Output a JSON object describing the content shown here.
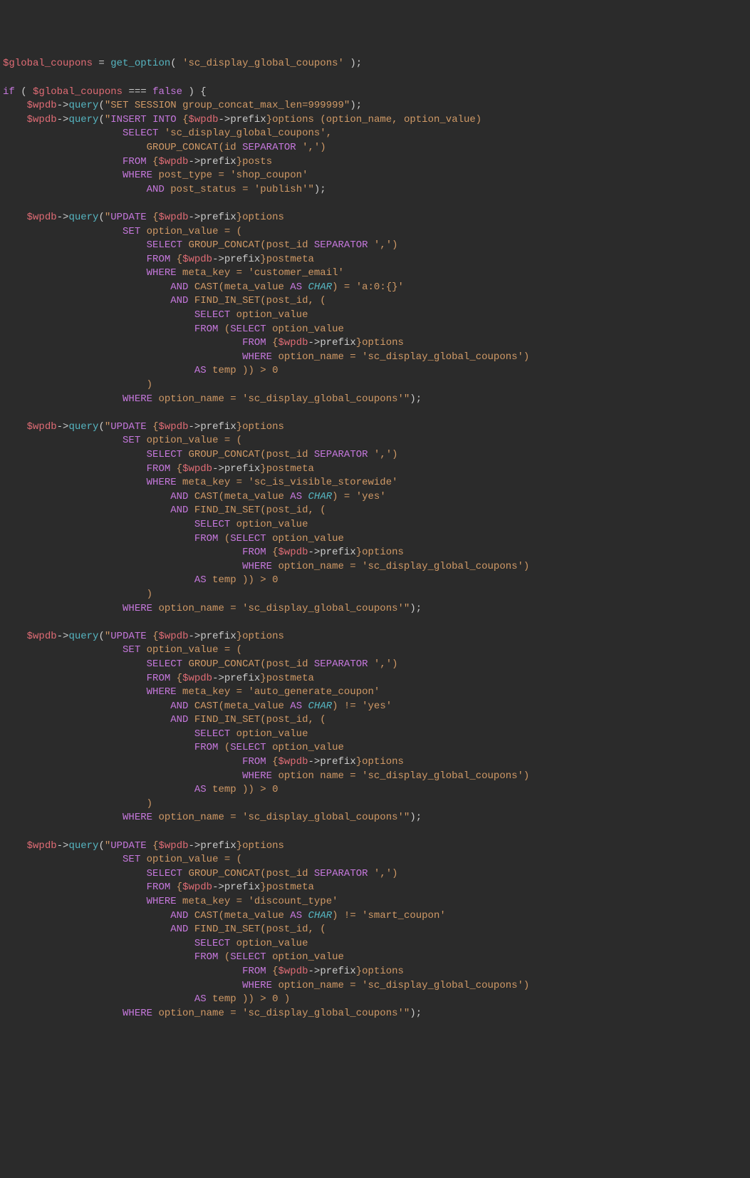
{
  "lines": [
    [
      [
        "var",
        "$global_coupons"
      ],
      [
        "op",
        " = "
      ],
      [
        "func",
        "get_option"
      ],
      [
        "paren",
        "( "
      ],
      [
        "str",
        "'sc_display_global_coupons'"
      ],
      [
        "paren",
        " );"
      ]
    ],
    [
      [
        "plain",
        ""
      ]
    ],
    [
      [
        "kw",
        "if"
      ],
      [
        "paren",
        " ( "
      ],
      [
        "var",
        "$global_coupons"
      ],
      [
        "op",
        " === "
      ],
      [
        "kw",
        "false"
      ],
      [
        "paren",
        " ) {"
      ]
    ],
    [
      [
        "plain",
        "    "
      ],
      [
        "var",
        "$wpdb"
      ],
      [
        "arrow",
        "->"
      ],
      [
        "method",
        "query"
      ],
      [
        "paren",
        "("
      ],
      [
        "str",
        "\"SET SESSION group_concat_max_len=999999\""
      ],
      [
        "paren",
        ");"
      ]
    ],
    [
      [
        "plain",
        "    "
      ],
      [
        "var",
        "$wpdb"
      ],
      [
        "arrow",
        "->"
      ],
      [
        "method",
        "query"
      ],
      [
        "paren",
        "("
      ],
      [
        "q-open",
        "\""
      ],
      [
        "sql-kw",
        "INSERT INTO"
      ],
      [
        "sql-str",
        " {"
      ],
      [
        "var",
        "$wpdb"
      ],
      [
        "arrow",
        "->"
      ],
      [
        "plain",
        "prefix"
      ],
      [
        "sql-str",
        "}options (option_name, option_value)"
      ]
    ],
    [
      [
        "plain",
        "                    "
      ],
      [
        "sql-kw",
        "SELECT"
      ],
      [
        "sql-str",
        " 'sc_display_global_coupons',"
      ]
    ],
    [
      [
        "plain",
        "                        "
      ],
      [
        "sql-str",
        "GROUP_CONCAT(id "
      ],
      [
        "sql-kw",
        "SEPARATOR"
      ],
      [
        "sql-str",
        " ',')"
      ]
    ],
    [
      [
        "plain",
        "                    "
      ],
      [
        "sql-kw",
        "FROM"
      ],
      [
        "sql-str",
        " {"
      ],
      [
        "var",
        "$wpdb"
      ],
      [
        "arrow",
        "->"
      ],
      [
        "plain",
        "prefix"
      ],
      [
        "sql-str",
        "}posts"
      ]
    ],
    [
      [
        "plain",
        "                    "
      ],
      [
        "sql-kw",
        "WHERE"
      ],
      [
        "sql-str",
        " post_type = 'shop_coupon'"
      ]
    ],
    [
      [
        "plain",
        "                        "
      ],
      [
        "sql-kw",
        "AND"
      ],
      [
        "sql-str",
        " post_status = 'publish'\""
      ],
      [
        "paren",
        ");"
      ]
    ],
    [
      [
        "plain",
        ""
      ]
    ],
    [
      [
        "plain",
        "    "
      ],
      [
        "var",
        "$wpdb"
      ],
      [
        "arrow",
        "->"
      ],
      [
        "method",
        "query"
      ],
      [
        "paren",
        "("
      ],
      [
        "q-open",
        "\""
      ],
      [
        "sql-kw",
        "UPDATE"
      ],
      [
        "sql-str",
        " {"
      ],
      [
        "var",
        "$wpdb"
      ],
      [
        "arrow",
        "->"
      ],
      [
        "plain",
        "prefix"
      ],
      [
        "sql-str",
        "}options"
      ]
    ],
    [
      [
        "plain",
        "                    "
      ],
      [
        "sql-kw",
        "SET"
      ],
      [
        "sql-str",
        " option_value = ("
      ]
    ],
    [
      [
        "plain",
        "                        "
      ],
      [
        "sql-kw",
        "SELECT"
      ],
      [
        "sql-str",
        " GROUP_CONCAT(post_id "
      ],
      [
        "sql-kw",
        "SEPARATOR"
      ],
      [
        "sql-str",
        " ',')"
      ]
    ],
    [
      [
        "plain",
        "                        "
      ],
      [
        "sql-kw",
        "FROM"
      ],
      [
        "sql-str",
        " {"
      ],
      [
        "var",
        "$wpdb"
      ],
      [
        "arrow",
        "->"
      ],
      [
        "plain",
        "prefix"
      ],
      [
        "sql-str",
        "}postmeta"
      ]
    ],
    [
      [
        "plain",
        "                        "
      ],
      [
        "sql-kw",
        "WHERE"
      ],
      [
        "sql-str",
        " meta_key = 'customer_email'"
      ]
    ],
    [
      [
        "plain",
        "                            "
      ],
      [
        "sql-kw",
        "AND"
      ],
      [
        "sql-str",
        " CAST(meta_value "
      ],
      [
        "sql-kw",
        "AS"
      ],
      [
        "sql-str",
        " "
      ],
      [
        "sql-type",
        "CHAR"
      ],
      [
        "sql-str",
        ") = 'a:0:{}'"
      ]
    ],
    [
      [
        "plain",
        "                            "
      ],
      [
        "sql-kw",
        "AND"
      ],
      [
        "sql-str",
        " FIND_IN_SET(post_id, ("
      ]
    ],
    [
      [
        "plain",
        "                                "
      ],
      [
        "sql-kw",
        "SELECT"
      ],
      [
        "sql-str",
        " option_value"
      ]
    ],
    [
      [
        "plain",
        "                                "
      ],
      [
        "sql-kw",
        "FROM"
      ],
      [
        "sql-str",
        " ("
      ],
      [
        "sql-kw",
        "SELECT"
      ],
      [
        "sql-str",
        " option_value"
      ]
    ],
    [
      [
        "plain",
        "                                        "
      ],
      [
        "sql-kw",
        "FROM"
      ],
      [
        "sql-str",
        " {"
      ],
      [
        "var",
        "$wpdb"
      ],
      [
        "arrow",
        "->"
      ],
      [
        "plain",
        "prefix"
      ],
      [
        "sql-str",
        "}options"
      ]
    ],
    [
      [
        "plain",
        "                                        "
      ],
      [
        "sql-kw",
        "WHERE"
      ],
      [
        "sql-str",
        " option_name = 'sc_display_global_coupons')"
      ]
    ],
    [
      [
        "plain",
        "                                "
      ],
      [
        "sql-kw",
        "AS"
      ],
      [
        "sql-str",
        " temp )) > "
      ],
      [
        "num",
        "0"
      ]
    ],
    [
      [
        "plain",
        "                        "
      ],
      [
        "sql-str",
        ")"
      ]
    ],
    [
      [
        "plain",
        "                    "
      ],
      [
        "sql-kw",
        "WHERE"
      ],
      [
        "sql-str",
        " option_name = 'sc_display_global_coupons'\""
      ],
      [
        "paren",
        ");"
      ]
    ],
    [
      [
        "plain",
        ""
      ]
    ],
    [
      [
        "plain",
        "    "
      ],
      [
        "var",
        "$wpdb"
      ],
      [
        "arrow",
        "->"
      ],
      [
        "method",
        "query"
      ],
      [
        "paren",
        "("
      ],
      [
        "q-open",
        "\""
      ],
      [
        "sql-kw",
        "UPDATE"
      ],
      [
        "sql-str",
        " {"
      ],
      [
        "var",
        "$wpdb"
      ],
      [
        "arrow",
        "->"
      ],
      [
        "plain",
        "prefix"
      ],
      [
        "sql-str",
        "}options"
      ]
    ],
    [
      [
        "plain",
        "                    "
      ],
      [
        "sql-kw",
        "SET"
      ],
      [
        "sql-str",
        " option_value = ("
      ]
    ],
    [
      [
        "plain",
        "                        "
      ],
      [
        "sql-kw",
        "SELECT"
      ],
      [
        "sql-str",
        " GROUP_CONCAT(post_id "
      ],
      [
        "sql-kw",
        "SEPARATOR"
      ],
      [
        "sql-str",
        " ',')"
      ]
    ],
    [
      [
        "plain",
        "                        "
      ],
      [
        "sql-kw",
        "FROM"
      ],
      [
        "sql-str",
        " {"
      ],
      [
        "var",
        "$wpdb"
      ],
      [
        "arrow",
        "->"
      ],
      [
        "plain",
        "prefix"
      ],
      [
        "sql-str",
        "}postmeta"
      ]
    ],
    [
      [
        "plain",
        "                        "
      ],
      [
        "sql-kw",
        "WHERE"
      ],
      [
        "sql-str",
        " meta_key = 'sc_is_visible_storewide'"
      ]
    ],
    [
      [
        "plain",
        "                            "
      ],
      [
        "sql-kw",
        "AND"
      ],
      [
        "sql-str",
        " CAST(meta_value "
      ],
      [
        "sql-kw",
        "AS"
      ],
      [
        "sql-str",
        " "
      ],
      [
        "sql-type",
        "CHAR"
      ],
      [
        "sql-str",
        ") = 'yes'"
      ]
    ],
    [
      [
        "plain",
        "                            "
      ],
      [
        "sql-kw",
        "AND"
      ],
      [
        "sql-str",
        " FIND_IN_SET(post_id, ("
      ]
    ],
    [
      [
        "plain",
        "                                "
      ],
      [
        "sql-kw",
        "SELECT"
      ],
      [
        "sql-str",
        " option_value"
      ]
    ],
    [
      [
        "plain",
        "                                "
      ],
      [
        "sql-kw",
        "FROM"
      ],
      [
        "sql-str",
        " ("
      ],
      [
        "sql-kw",
        "SELECT"
      ],
      [
        "sql-str",
        " option_value"
      ]
    ],
    [
      [
        "plain",
        "                                        "
      ],
      [
        "sql-kw",
        "FROM"
      ],
      [
        "sql-str",
        " {"
      ],
      [
        "var",
        "$wpdb"
      ],
      [
        "arrow",
        "->"
      ],
      [
        "plain",
        "prefix"
      ],
      [
        "sql-str",
        "}options"
      ]
    ],
    [
      [
        "plain",
        "                                        "
      ],
      [
        "sql-kw",
        "WHERE"
      ],
      [
        "sql-str",
        " option_name = 'sc_display_global_coupons')"
      ]
    ],
    [
      [
        "plain",
        "                                "
      ],
      [
        "sql-kw",
        "AS"
      ],
      [
        "sql-str",
        " temp )) > "
      ],
      [
        "num",
        "0"
      ]
    ],
    [
      [
        "plain",
        "                        "
      ],
      [
        "sql-str",
        ")"
      ]
    ],
    [
      [
        "plain",
        "                    "
      ],
      [
        "sql-kw",
        "WHERE"
      ],
      [
        "sql-str",
        " option_name = 'sc_display_global_coupons'\""
      ],
      [
        "paren",
        ");"
      ]
    ],
    [
      [
        "plain",
        ""
      ]
    ],
    [
      [
        "plain",
        "    "
      ],
      [
        "var",
        "$wpdb"
      ],
      [
        "arrow",
        "->"
      ],
      [
        "method",
        "query"
      ],
      [
        "paren",
        "("
      ],
      [
        "q-open",
        "\""
      ],
      [
        "sql-kw",
        "UPDATE"
      ],
      [
        "sql-str",
        " {"
      ],
      [
        "var",
        "$wpdb"
      ],
      [
        "arrow",
        "->"
      ],
      [
        "plain",
        "prefix"
      ],
      [
        "sql-str",
        "}options"
      ]
    ],
    [
      [
        "plain",
        "                    "
      ],
      [
        "sql-kw",
        "SET"
      ],
      [
        "sql-str",
        " option_value = ("
      ]
    ],
    [
      [
        "plain",
        "                        "
      ],
      [
        "sql-kw",
        "SELECT"
      ],
      [
        "sql-str",
        " GROUP_CONCAT(post_id "
      ],
      [
        "sql-kw",
        "SEPARATOR"
      ],
      [
        "sql-str",
        " ',')"
      ]
    ],
    [
      [
        "plain",
        "                        "
      ],
      [
        "sql-kw",
        "FROM"
      ],
      [
        "sql-str",
        " {"
      ],
      [
        "var",
        "$wpdb"
      ],
      [
        "arrow",
        "->"
      ],
      [
        "plain",
        "prefix"
      ],
      [
        "sql-str",
        "}postmeta"
      ]
    ],
    [
      [
        "plain",
        "                        "
      ],
      [
        "sql-kw",
        "WHERE"
      ],
      [
        "sql-str",
        " meta_key = 'auto_generate_coupon'"
      ]
    ],
    [
      [
        "plain",
        "                            "
      ],
      [
        "sql-kw",
        "AND"
      ],
      [
        "sql-str",
        " CAST(meta_value "
      ],
      [
        "sql-kw",
        "AS"
      ],
      [
        "sql-str",
        " "
      ],
      [
        "sql-type",
        "CHAR"
      ],
      [
        "sql-str",
        ") != 'yes'"
      ]
    ],
    [
      [
        "plain",
        "                            "
      ],
      [
        "sql-kw",
        "AND"
      ],
      [
        "sql-str",
        " FIND_IN_SET(post_id, ("
      ]
    ],
    [
      [
        "plain",
        "                                "
      ],
      [
        "sql-kw",
        "SELECT"
      ],
      [
        "sql-str",
        " option_value"
      ]
    ],
    [
      [
        "plain",
        "                                "
      ],
      [
        "sql-kw",
        "FROM"
      ],
      [
        "sql-str",
        " ("
      ],
      [
        "sql-kw",
        "SELECT"
      ],
      [
        "sql-str",
        " option_value"
      ]
    ],
    [
      [
        "plain",
        "                                        "
      ],
      [
        "sql-kw",
        "FROM"
      ],
      [
        "sql-str",
        " {"
      ],
      [
        "var",
        "$wpdb"
      ],
      [
        "arrow",
        "->"
      ],
      [
        "plain",
        "prefix"
      ],
      [
        "sql-str",
        "}options"
      ]
    ],
    [
      [
        "plain",
        "                                        "
      ],
      [
        "sql-kw",
        "WHERE"
      ],
      [
        "sql-str",
        " option name = 'sc_display_global_coupons')"
      ]
    ],
    [
      [
        "plain",
        "                                "
      ],
      [
        "sql-kw",
        "AS"
      ],
      [
        "sql-str",
        " temp )) > "
      ],
      [
        "num",
        "0"
      ]
    ],
    [
      [
        "plain",
        "                        "
      ],
      [
        "sql-str",
        ")"
      ]
    ],
    [
      [
        "plain",
        "                    "
      ],
      [
        "sql-kw",
        "WHERE"
      ],
      [
        "sql-str",
        " option_name = 'sc_display_global_coupons'\""
      ],
      [
        "paren",
        ");"
      ]
    ],
    [
      [
        "plain",
        ""
      ]
    ],
    [
      [
        "plain",
        "    "
      ],
      [
        "var",
        "$wpdb"
      ],
      [
        "arrow",
        "->"
      ],
      [
        "method",
        "query"
      ],
      [
        "paren",
        "("
      ],
      [
        "q-open",
        "\""
      ],
      [
        "sql-kw",
        "UPDATE"
      ],
      [
        "sql-str",
        " {"
      ],
      [
        "var",
        "$wpdb"
      ],
      [
        "arrow",
        "->"
      ],
      [
        "plain",
        "prefix"
      ],
      [
        "sql-str",
        "}options"
      ]
    ],
    [
      [
        "plain",
        "                    "
      ],
      [
        "sql-kw",
        "SET"
      ],
      [
        "sql-str",
        " option_value = ("
      ]
    ],
    [
      [
        "plain",
        "                        "
      ],
      [
        "sql-kw",
        "SELECT"
      ],
      [
        "sql-str",
        " GROUP_CONCAT(post_id "
      ],
      [
        "sql-kw",
        "SEPARATOR"
      ],
      [
        "sql-str",
        " ',')"
      ]
    ],
    [
      [
        "plain",
        "                        "
      ],
      [
        "sql-kw",
        "FROM"
      ],
      [
        "sql-str",
        " {"
      ],
      [
        "var",
        "$wpdb"
      ],
      [
        "arrow",
        "->"
      ],
      [
        "plain",
        "prefix"
      ],
      [
        "sql-str",
        "}postmeta"
      ]
    ],
    [
      [
        "plain",
        "                        "
      ],
      [
        "sql-kw",
        "WHERE"
      ],
      [
        "sql-str",
        " meta_key = 'discount_type'"
      ]
    ],
    [
      [
        "plain",
        "                            "
      ],
      [
        "sql-kw",
        "AND"
      ],
      [
        "sql-str",
        " CAST(meta_value "
      ],
      [
        "sql-kw",
        "AS"
      ],
      [
        "sql-str",
        " "
      ],
      [
        "sql-type",
        "CHAR"
      ],
      [
        "sql-str",
        ") != 'smart_coupon'"
      ]
    ],
    [
      [
        "plain",
        "                            "
      ],
      [
        "sql-kw",
        "AND"
      ],
      [
        "sql-str",
        " FIND_IN_SET(post_id, ("
      ]
    ],
    [
      [
        "plain",
        "                                "
      ],
      [
        "sql-kw",
        "SELECT"
      ],
      [
        "sql-str",
        " option_value"
      ]
    ],
    [
      [
        "plain",
        "                                "
      ],
      [
        "sql-kw",
        "FROM"
      ],
      [
        "sql-str",
        " ("
      ],
      [
        "sql-kw",
        "SELECT"
      ],
      [
        "sql-str",
        " option_value"
      ]
    ],
    [
      [
        "plain",
        "                                        "
      ],
      [
        "sql-kw",
        "FROM"
      ],
      [
        "sql-str",
        " {"
      ],
      [
        "var",
        "$wpdb"
      ],
      [
        "arrow",
        "->"
      ],
      [
        "plain",
        "prefix"
      ],
      [
        "sql-str",
        "}options"
      ]
    ],
    [
      [
        "plain",
        "                                        "
      ],
      [
        "sql-kw",
        "WHERE"
      ],
      [
        "sql-str",
        " option_name = 'sc_display_global_coupons')"
      ]
    ],
    [
      [
        "plain",
        "                                "
      ],
      [
        "sql-kw",
        "AS"
      ],
      [
        "sql-str",
        " temp )) > "
      ],
      [
        "num",
        "0"
      ],
      [
        "sql-str",
        " )"
      ]
    ],
    [
      [
        "plain",
        "                    "
      ],
      [
        "sql-kw",
        "WHERE"
      ],
      [
        "sql-str",
        " option_name = 'sc_display_global_coupons'\""
      ],
      [
        "paren",
        ");"
      ]
    ]
  ]
}
